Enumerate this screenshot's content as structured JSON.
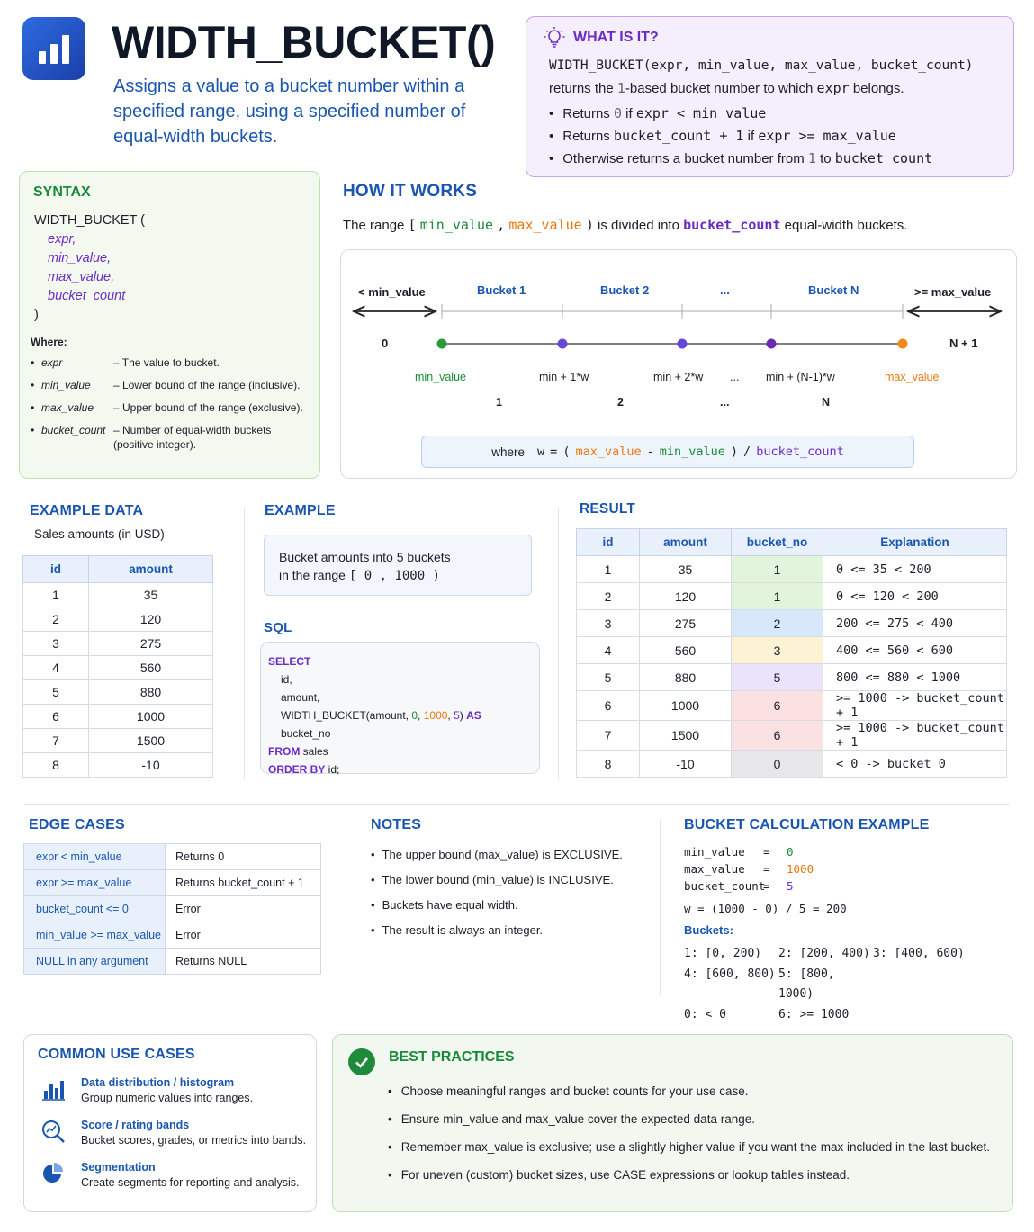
{
  "header": {
    "title": "WIDTH_BUCKET()",
    "subtitle": "Assigns a value to a bucket number within a specified range, using a specified number of equal-width buckets."
  },
  "what_is_it": {
    "title": "WHAT IS IT?",
    "signature": "WIDTH_BUCKET(expr, min_value, max_value, bucket_count)",
    "description_pre": "returns the ",
    "description_one": "1",
    "description_mid": "-based bucket number to which ",
    "description_expr": "expr",
    "description_post": " belongs.",
    "bullets": [
      {
        "a": "Returns ",
        "n": "0",
        "b": " if ",
        "c": "expr < min_value"
      },
      {
        "a": "Returns ",
        "n": "bucket_count + 1",
        "b": " if ",
        "c": "expr >= max_value"
      },
      {
        "a": "Otherwise returns a bucket number from ",
        "n": "1",
        "b": " to ",
        "c": "bucket_count"
      }
    ]
  },
  "syntax": {
    "title": "SYNTAX",
    "fn_open": "WIDTH_BUCKET (",
    "args": [
      "expr,",
      "min_value,",
      "max_value,",
      "bucket_count"
    ],
    "close": ")",
    "where": "Where:",
    "defs": [
      {
        "k": "expr",
        "d": "– The value to bucket."
      },
      {
        "k": "min_value",
        "d": "– Lower bound of the range (inclusive)."
      },
      {
        "k": "max_value",
        "d": "– Upper bound of the range (exclusive)."
      },
      {
        "k": "bucket_count",
        "d": "– Number of equal-width buckets (positive integer)."
      }
    ]
  },
  "how": {
    "title": "HOW IT WORKS",
    "text_a": "The range ",
    "bracket_open": "[",
    "min": "min_value",
    "comma": ",",
    "max": "max_value",
    "bracket_close": ")",
    "text_b": " is divided into ",
    "count": "bucket_count",
    "text_c": " equal-width buckets.",
    "top_labels": [
      "< min_value",
      "Bucket 1",
      "Bucket 2",
      "...",
      "Bucket N",
      ">= max_value"
    ],
    "zero": "0",
    "n_plus_1": "N + 1",
    "point_labels": [
      "min_value",
      "min + 1*w",
      "min + 2*w",
      "...",
      "min + (N-1)*w",
      "max_value"
    ],
    "bucket_numbers": [
      "1",
      "2",
      "...",
      "N"
    ],
    "formula": {
      "where": "where",
      "w": "w",
      "eq": "=",
      "open": "(",
      "max": "max_value",
      "minus": "-",
      "min": "min_value",
      "close": ")",
      "slash": "/",
      "count": "bucket_count"
    }
  },
  "example_data": {
    "title": "EXAMPLE DATA",
    "subtitle": "Sales amounts (in USD)",
    "headers": [
      "id",
      "amount"
    ],
    "rows": [
      [
        "1",
        "35"
      ],
      [
        "2",
        "120"
      ],
      [
        "3",
        "275"
      ],
      [
        "4",
        "560"
      ],
      [
        "5",
        "880"
      ],
      [
        "6",
        "1000"
      ],
      [
        "7",
        "1500"
      ],
      [
        "8",
        "-10"
      ]
    ]
  },
  "example": {
    "title": "EXAMPLE",
    "line1": "Bucket amounts into 5 buckets",
    "line2_a": "in the range ",
    "line2_b": "[ 0 , 1000 )",
    "sql_title": "SQL",
    "sql": {
      "select": "SELECT",
      "id": "id,",
      "amount": "amount,",
      "fn": "WIDTH_BUCKET(amount, ",
      "a0": "0",
      "a1": "1000",
      "a2": "5",
      "close": ") ",
      "as": "AS",
      "alias": " bucket_no",
      "from": "FROM",
      "table": " sales",
      "order": "ORDER BY",
      "orderby": " id;"
    }
  },
  "result": {
    "title": "RESULT",
    "headers": [
      "id",
      "amount",
      "bucket_no",
      "Explanation"
    ],
    "rows": [
      {
        "id": "1",
        "amount": "35",
        "bucket": "1",
        "exp": "0 <= 35 < 200",
        "color": "#e3f4dc"
      },
      {
        "id": "2",
        "amount": "120",
        "bucket": "1",
        "exp": "0 <= 120 < 200",
        "color": "#e3f4dc"
      },
      {
        "id": "3",
        "amount": "275",
        "bucket": "2",
        "exp": "200 <= 275 < 400",
        "color": "#d8e8fb"
      },
      {
        "id": "4",
        "amount": "560",
        "bucket": "3",
        "exp": "400 <= 560 < 600",
        "color": "#fdf2d3"
      },
      {
        "id": "5",
        "amount": "880",
        "bucket": "5",
        "exp": "800 <= 880 < 1000",
        "color": "#ebe2fb"
      },
      {
        "id": "6",
        "amount": "1000",
        "bucket": "6",
        "exp": ">= 1000 -> bucket_count + 1",
        "color": "#fbe1e1"
      },
      {
        "id": "7",
        "amount": "1500",
        "bucket": "6",
        "exp": ">= 1000 -> bucket_count + 1",
        "color": "#fbe1e1"
      },
      {
        "id": "8",
        "amount": "-10",
        "bucket": "0",
        "exp": "< 0 -> bucket 0",
        "color": "#e7e7ea"
      }
    ]
  },
  "edge_cases": {
    "title": "EDGE CASES",
    "rows": [
      {
        "k": "expr < min_value",
        "v": "Returns 0"
      },
      {
        "k": "expr >= max_value",
        "v": "Returns bucket_count + 1"
      },
      {
        "k": "bucket_count <= 0",
        "v": "Error"
      },
      {
        "k": "min_value >= max_value",
        "v": "Error"
      },
      {
        "k": "NULL in any argument",
        "v": "Returns NULL"
      }
    ]
  },
  "notes": {
    "title": "NOTES",
    "items": [
      "The upper bound (max_value) is EXCLUSIVE.",
      "The lower bound (min_value) is INCLUSIVE.",
      "Buckets have equal width.",
      "The result is always an integer."
    ]
  },
  "bucket_calc": {
    "title": "BUCKET CALCULATION EXAMPLE",
    "vars": [
      {
        "k": "min_value",
        "v": "0",
        "c": "#1a8a3a"
      },
      {
        "k": "max_value",
        "v": "1000",
        "c": "#e8780f"
      },
      {
        "k": "bucket_count",
        "v": "5",
        "c": "#6b2bc7"
      }
    ],
    "eq": "=",
    "w_line": "w = (1000 - 0) / 5 = 200",
    "buckets_label": "Buckets:",
    "buckets": [
      [
        "1: [0, 200)",
        "2: [200, 400)",
        "3: [400, 600)"
      ],
      [
        "4: [600, 800)",
        "5: [800, 1000)"
      ],
      [
        "0: < 0",
        "6: >= 1000"
      ]
    ]
  },
  "common": {
    "title": "COMMON USE CASES",
    "items": [
      {
        "icon": "bar-chart-icon",
        "t": "Data distribution / histogram",
        "d": "Group numeric values into ranges."
      },
      {
        "icon": "magnifier-chart-icon",
        "t": "Score / rating bands",
        "d": "Bucket scores, grades, or metrics into bands."
      },
      {
        "icon": "pie-chart-icon",
        "t": "Segmentation",
        "d": "Create segments for reporting and analysis."
      }
    ]
  },
  "best": {
    "title": "BEST PRACTICES",
    "items": [
      "Choose meaningful ranges and bucket counts for your use case.",
      "Ensure min_value and max_value cover the expected data range.",
      "Remember max_value is exclusive; use a slightly higher value if you want the max included in the last bucket.",
      "For uneven (custom) bucket sizes, use CASE expressions or lookup tables instead."
    ]
  },
  "colors": {
    "accent": "#1a56b0",
    "green": "#1a8a3a",
    "orange": "#e8780f",
    "purple": "#6b2bc7"
  }
}
